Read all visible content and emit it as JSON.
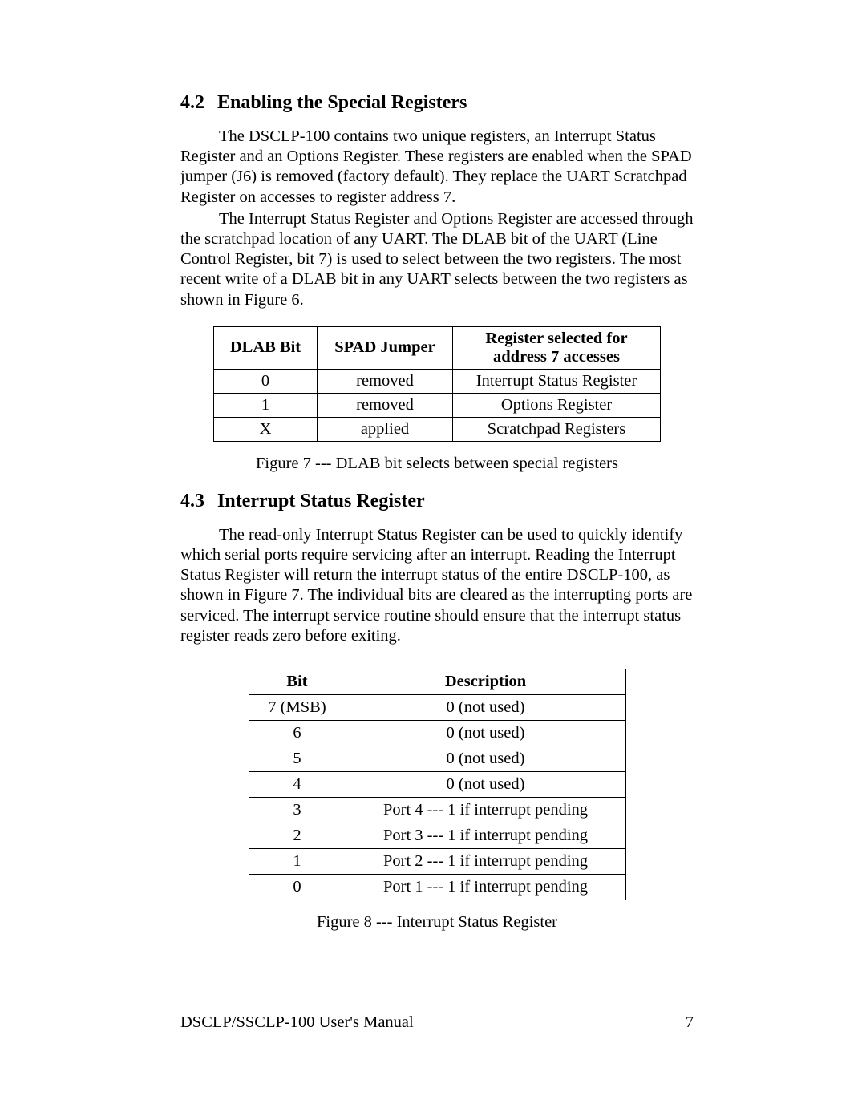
{
  "section42": {
    "number": "4.2",
    "title": "Enabling the Special Registers",
    "p1": "The DSCLP-100 contains two unique registers, an Interrupt Status Register and an Options Register.  These registers are enabled when the SPAD jumper (J6) is removed (factory default).  They replace the UART Scratchpad Register on accesses to register address 7.",
    "p2": "The Interrupt Status Register and Options Register are  accessed through the scratchpad location of any UART.  The DLAB bit of the UART (Line Control Register, bit 7) is used to select between the two registers.  The most recent write of a DLAB bit in any UART selects between the two registers as shown in Figure 6."
  },
  "table1": {
    "headers": {
      "h1": "DLAB Bit",
      "h2": "SPAD Jumper",
      "h3_line1": "Register selected for",
      "h3_line2": "address 7 accesses"
    },
    "rows": [
      {
        "c1": "0",
        "c2": "removed",
        "c3": "Interrupt Status Register"
      },
      {
        "c1": "1",
        "c2": "removed",
        "c3": "Options Register"
      },
      {
        "c1": "X",
        "c2": "applied",
        "c3": "Scratchpad Registers"
      }
    ],
    "caption": "Figure 7 --- DLAB bit selects between special registers"
  },
  "section43": {
    "number": "4.3",
    "title": "Interrupt Status Register",
    "p1": "The read-only Interrupt Status Register can be used to quickly identify which serial ports require servicing after an interrupt.  Reading the Interrupt Status Register will return the interrupt status of the entire DSCLP-100, as shown in Figure 7.  The individual bits are cleared as the interrupting ports are serviced.  The interrupt service routine should ensure that the interrupt status register reads zero before exiting."
  },
  "table2": {
    "headers": {
      "h1": "Bit",
      "h2": "Description"
    },
    "rows": [
      {
        "c1": "7  (MSB)",
        "c2": "0 (not used)"
      },
      {
        "c1": "6",
        "c2": "0 (not used)"
      },
      {
        "c1": "5",
        "c2": "0 (not used)"
      },
      {
        "c1": "4",
        "c2": "0 (not used)"
      },
      {
        "c1": "3",
        "c2": "Port 4 --- 1 if interrupt pending"
      },
      {
        "c1": "2",
        "c2": "Port 3 --- 1 if interrupt pending"
      },
      {
        "c1": "1",
        "c2": "Port 2 --- 1 if interrupt pending"
      },
      {
        "c1": "0",
        "c2": "Port 1 --- 1 if interrupt pending"
      }
    ],
    "caption": "Figure 8 --- Interrupt Status Register"
  },
  "footer": {
    "left": "DSCLP/SSCLP-100 User's Manual",
    "right": "7"
  }
}
